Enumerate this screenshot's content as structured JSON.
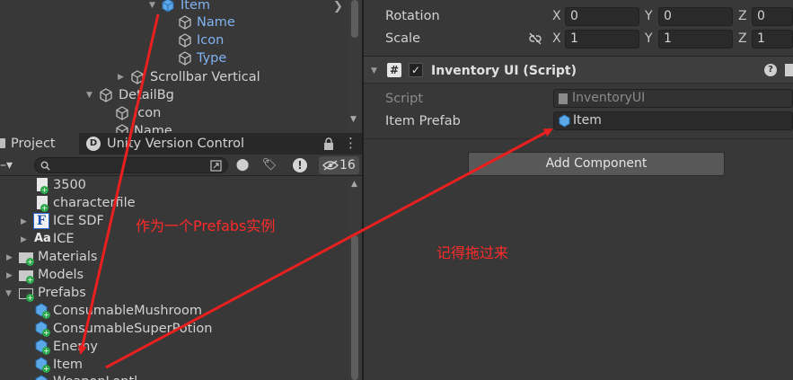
{
  "hierarchy": {
    "items": [
      {
        "label": "Item",
        "selected": true
      },
      {
        "label": "Name"
      },
      {
        "label": "Icon"
      },
      {
        "label": "Type"
      },
      {
        "label": "Scrollbar Vertical"
      },
      {
        "label": "DetailBg"
      },
      {
        "label": "Icon"
      },
      {
        "label": "Name"
      }
    ]
  },
  "project": {
    "tabs": {
      "project": "Project",
      "uvc": "Unity Version Control"
    },
    "search": {
      "placeholder": ""
    },
    "hidden_count": "16",
    "items": [
      {
        "label": "3500"
      },
      {
        "label": "characterfile"
      },
      {
        "label": "ICE SDF"
      },
      {
        "label": "ICE"
      },
      {
        "label": "Materials"
      },
      {
        "label": "Models"
      },
      {
        "label": "Prefabs"
      },
      {
        "label": "ConsumableMushroom"
      },
      {
        "label": "ConsumableSuperPotion"
      },
      {
        "label": "Enemy"
      },
      {
        "label": "Item"
      },
      {
        "label": "WeaponLontl..."
      }
    ]
  },
  "inspector": {
    "rotation": {
      "label": "Rotation",
      "x": "0",
      "y": "0",
      "z": "0"
    },
    "scale": {
      "label": "Scale",
      "x": "1",
      "y": "1",
      "z": "1"
    },
    "axes": {
      "x": "X",
      "y": "Y",
      "z": "Z"
    },
    "component": {
      "title": "Inventory UI (Script)",
      "script_label": "Script",
      "script_value": "InventoryUI",
      "prefab_label": "Item Prefab",
      "prefab_value": "Item"
    },
    "add_component": "Add Component"
  },
  "annotations": {
    "prefab_note": "作为一个Prefabs实例",
    "drag_note": "记得拖过来"
  },
  "colors": {
    "arrow": "#e8201f",
    "selected_text": "#7fb2f0",
    "note": "#ff2a2a"
  }
}
